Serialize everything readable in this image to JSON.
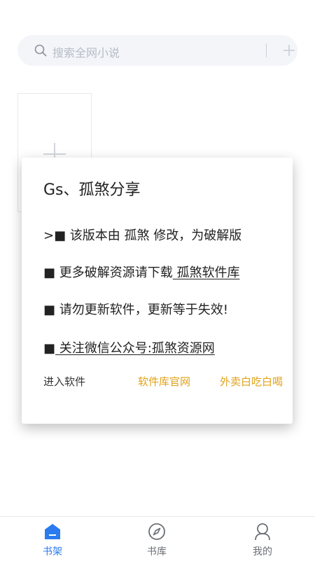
{
  "search": {
    "placeholder": "搜索全网小说"
  },
  "dialog": {
    "title": "Gs、孤煞分享",
    "line1": ">■ 该版本由 孤煞 修改，为破解版",
    "line2_prefix": "■ 更多破解资源请下载",
    "line2_link": " 孤煞软件库 ",
    "line3": "■ 请勿更新软件，更新等于失效!",
    "line4_prefix": "■",
    "line4_link": " 关注微信公众号:孤煞资源网 ",
    "actions": {
      "enter": "进入软件",
      "site": "软件库官网",
      "food": "外卖白吃白喝"
    }
  },
  "tabs": [
    {
      "label": "书架",
      "icon": "bookshelf-icon",
      "active": true
    },
    {
      "label": "书库",
      "icon": "compass-icon",
      "active": false
    },
    {
      "label": "我的",
      "icon": "user-icon",
      "active": false
    }
  ],
  "colors": {
    "accent": "#2a7bf0",
    "link": "#e0a21a",
    "search_bg": "#f3f5f9"
  }
}
